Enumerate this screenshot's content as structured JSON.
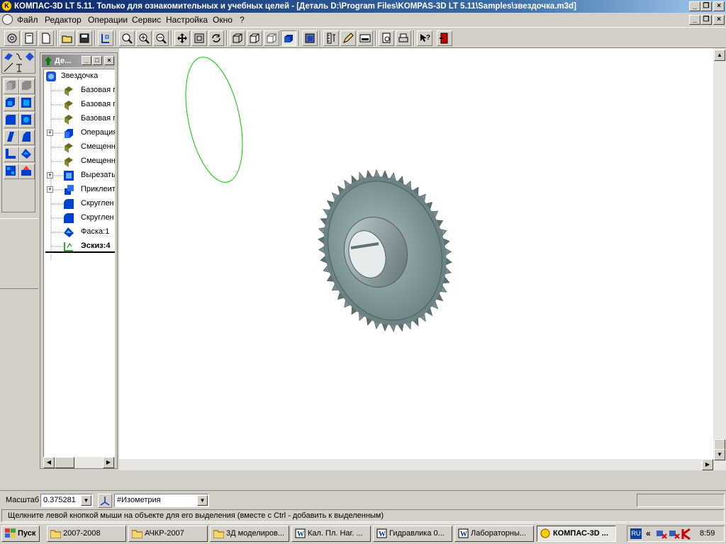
{
  "window": {
    "title": "КОМПАС-3D LT 5.11. Только для ознакомительных и учебных целей - [Деталь D:\\Program Files\\KOMPAS-3D LT 5.11\\Samples\\звездочка.m3d]",
    "app_icon": "kompas-logo-icon",
    "minimize_glyph": "_",
    "maximize_glyph": "❐",
    "close_glyph": "×"
  },
  "menu": {
    "items": [
      "Файл",
      "Редактор",
      "Операции",
      "Сервис",
      "Настройка",
      "Окно",
      "?"
    ]
  },
  "tree": {
    "title": "Де...",
    "items": [
      {
        "label": "Звездочка",
        "icon": "part-icon",
        "expand": false,
        "root": true
      },
      {
        "label": "Базовая п",
        "icon": "plane-icon",
        "expand": false
      },
      {
        "label": "Базовая п",
        "icon": "plane-icon",
        "expand": false
      },
      {
        "label": "Базовая п",
        "icon": "plane-icon",
        "expand": false
      },
      {
        "label": "Операция",
        "icon": "extrude-icon",
        "expand": true
      },
      {
        "label": "Смещенна",
        "icon": "plane-icon",
        "expand": false
      },
      {
        "label": "Смещенна",
        "icon": "plane-icon",
        "expand": false
      },
      {
        "label": "Вырезать",
        "icon": "cut-icon",
        "expand": true
      },
      {
        "label": "Приклеит",
        "icon": "glue-icon",
        "expand": true
      },
      {
        "label": "Скруглен",
        "icon": "fillet-icon",
        "expand": false
      },
      {
        "label": "Скруглен",
        "icon": "fillet-icon",
        "expand": false
      },
      {
        "label": "Фаска:1",
        "icon": "chamfer-icon",
        "expand": false
      },
      {
        "label": "Эскиз:4",
        "icon": "sketch-icon",
        "expand": false,
        "bold": true
      }
    ]
  },
  "status": {
    "scale_label": "Масштаб",
    "scale_value": "0.375281",
    "view_value": "#Изометрия"
  },
  "hint": "Щелкните левой кнопкой мыши на объекте для его выделения (вместе с Ctrl - добавить к выделенным)",
  "taskbar": {
    "start": "Пуск",
    "tasks": [
      {
        "label": "2007-2008",
        "icon": "folder-icon"
      },
      {
        "label": "АЧКР-2007",
        "icon": "folder-icon"
      },
      {
        "label": "3Д моделиров...",
        "icon": "folder-icon"
      },
      {
        "label": "Кал. Пл. Наг. ...",
        "icon": "word-icon"
      },
      {
        "label": "Гидравлика 0...",
        "icon": "word-icon"
      },
      {
        "label": "Лабораторны...",
        "icon": "word-icon"
      },
      {
        "label": "КОМПАС-3D ...",
        "icon": "kompas-icon",
        "active": true
      }
    ],
    "lang": "RU",
    "clock": "8:59",
    "expand_glyph": "«"
  },
  "colors": {
    "title_active": "#0a246a",
    "sketch_green": "#00cc00",
    "gear_body": "#8fa5a8"
  }
}
